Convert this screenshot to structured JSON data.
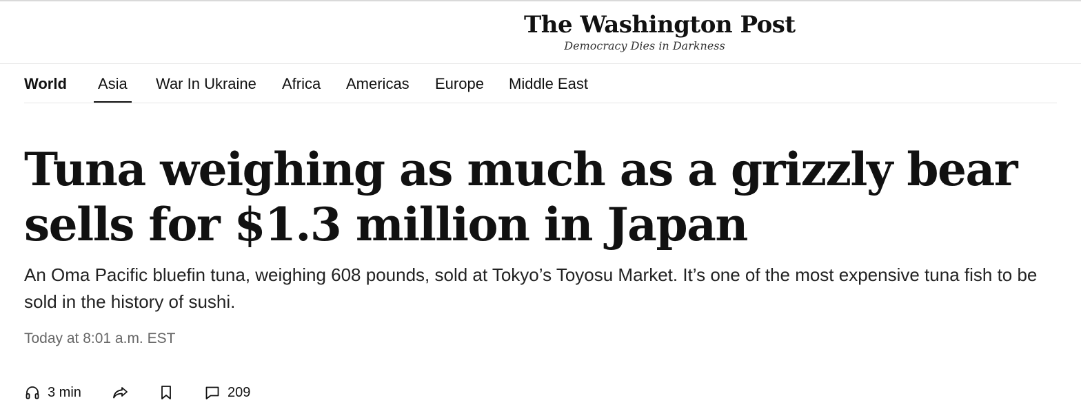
{
  "masthead": {
    "logo": "The Washington Post",
    "tagline": "Democracy Dies in Darkness"
  },
  "nav": {
    "section": "World",
    "items": [
      {
        "label": "Asia",
        "active": true
      },
      {
        "label": "War In Ukraine"
      },
      {
        "label": "Africa"
      },
      {
        "label": "Americas"
      },
      {
        "label": "Europe"
      },
      {
        "label": "Middle East"
      }
    ]
  },
  "article": {
    "headline": "Tuna weighing as much as a grizzly bear sells for $1.3 million in Japan",
    "dek": "An Oma Pacific bluefin tuna, weighing 608 pounds, sold at Tokyo’s Toyosu Market. It’s one of the most expensive tuna fish to be sold in the history of sushi.",
    "timestamp": "Today at 8:01 a.m. EST"
  },
  "actions": {
    "listen_label": "3 min",
    "listen_icon": "headphones-icon",
    "share_icon": "share-icon",
    "save_icon": "bookmark-icon",
    "comments_icon": "comment-icon",
    "comments_count": "209"
  }
}
